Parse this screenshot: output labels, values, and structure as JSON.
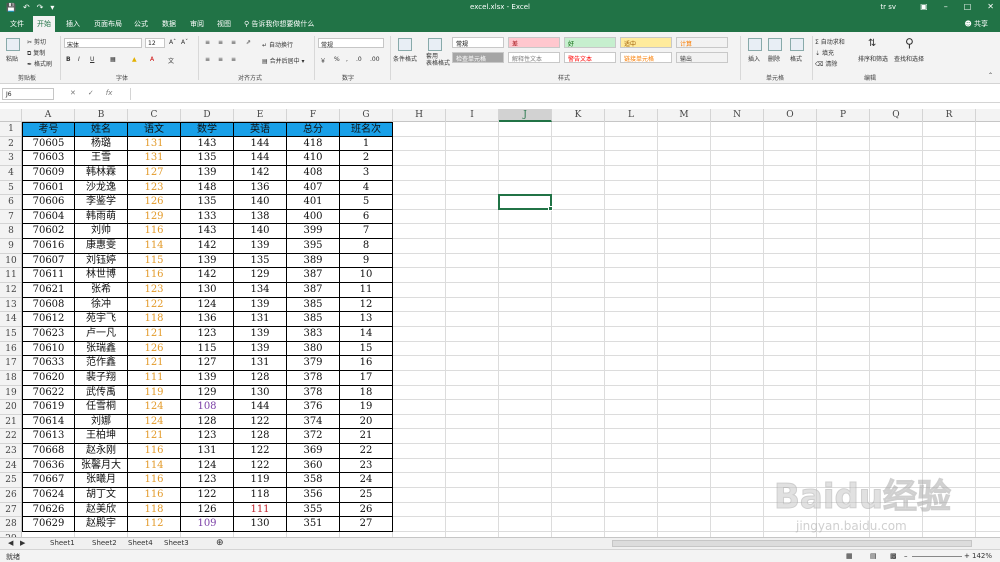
{
  "window": {
    "title": "excel.xlsx - Excel",
    "user": "tr sv",
    "share": "共享"
  },
  "tabs": [
    "文件",
    "开始",
    "插入",
    "页面布局",
    "公式",
    "数据",
    "审阅",
    "视图"
  ],
  "tell_me": "告诉我你想要做什么",
  "ribbon": {
    "clipboard": {
      "paste": "粘贴",
      "cut": "剪切",
      "copy": "复制",
      "format_painter": "格式刷",
      "label": "剪贴板"
    },
    "font": {
      "name": "宋体",
      "size": "12",
      "label": "字体"
    },
    "alignment": {
      "wrap": "自动换行",
      "merge": "合并后居中",
      "label": "对齐方式"
    },
    "number": {
      "format": "常规",
      "label": "数字"
    },
    "styles": {
      "cond": "条件格式",
      "table": "套用\n表格格式",
      "cells": [
        {
          "text": "常规",
          "bg": "#ffffff",
          "fg": "#000000"
        },
        {
          "text": "差",
          "bg": "#ffc7ce",
          "fg": "#9c0006"
        },
        {
          "text": "好",
          "bg": "#c6efce",
          "fg": "#006100"
        },
        {
          "text": "适中",
          "bg": "#ffeb9c",
          "fg": "#9c5700"
        },
        {
          "text": "计算",
          "bg": "#f2f2f2",
          "fg": "#fa7d00"
        },
        {
          "text": "检查单元格",
          "bg": "#a5a5a5",
          "fg": "#ffffff"
        },
        {
          "text": "解释性文本",
          "bg": "#ffffff",
          "fg": "#7f7f7f"
        },
        {
          "text": "警告文本",
          "bg": "#ffffff",
          "fg": "#ff0000"
        },
        {
          "text": "链接单元格",
          "bg": "#ffffff",
          "fg": "#fa7d00"
        },
        {
          "text": "输出",
          "bg": "#f2f2f2",
          "fg": "#3f3f3f"
        }
      ],
      "label": "样式"
    },
    "cells": {
      "insert": "插入",
      "delete": "删除",
      "format": "格式",
      "label": "单元格"
    },
    "editing": {
      "autosum": "自动求和",
      "fill": "填充",
      "clear": "清除",
      "sort": "排序和筛选",
      "find": "查找和选择",
      "label": "编辑"
    }
  },
  "formula_bar": {
    "name_box": "J6",
    "fx": "fx",
    "value": ""
  },
  "columns": [
    "A",
    "B",
    "C",
    "D",
    "E",
    "F",
    "G",
    "H",
    "I",
    "J",
    "K",
    "L",
    "M",
    "N",
    "O",
    "P",
    "Q",
    "R"
  ],
  "selected_column": "J",
  "headers": [
    "考号",
    "姓名",
    "语文",
    "数学",
    "英语",
    "总分",
    "班名次"
  ],
  "rows": [
    [
      "70605",
      "杨璐",
      "131",
      "143",
      "144",
      "418",
      "1"
    ],
    [
      "70603",
      "王雪",
      "131",
      "135",
      "144",
      "410",
      "2"
    ],
    [
      "70609",
      "韩林霖",
      "127",
      "139",
      "142",
      "408",
      "3"
    ],
    [
      "70601",
      "沙龙逸",
      "123",
      "148",
      "136",
      "407",
      "4"
    ],
    [
      "70606",
      "李鉴学",
      "126",
      "135",
      "140",
      "401",
      "5"
    ],
    [
      "70604",
      "韩雨萌",
      "129",
      "133",
      "138",
      "400",
      "6"
    ],
    [
      "70602",
      "刘帅",
      "116",
      "143",
      "140",
      "399",
      "7"
    ],
    [
      "70616",
      "康惠雯",
      "114",
      "142",
      "139",
      "395",
      "8"
    ],
    [
      "70607",
      "刘钰婷",
      "115",
      "139",
      "135",
      "389",
      "9"
    ],
    [
      "70611",
      "林世博",
      "116",
      "142",
      "129",
      "387",
      "10"
    ],
    [
      "70621",
      "张希",
      "123",
      "130",
      "134",
      "387",
      "11"
    ],
    [
      "70608",
      "徐冲",
      "122",
      "124",
      "139",
      "385",
      "12"
    ],
    [
      "70612",
      "苑宇飞",
      "118",
      "136",
      "131",
      "385",
      "13"
    ],
    [
      "70623",
      "卢一凡",
      "121",
      "123",
      "139",
      "383",
      "14"
    ],
    [
      "70610",
      "张瑞鑫",
      "126",
      "115",
      "139",
      "380",
      "15"
    ],
    [
      "70633",
      "范作鑫",
      "121",
      "127",
      "131",
      "379",
      "16"
    ],
    [
      "70620",
      "裴子翔",
      "111",
      "139",
      "128",
      "378",
      "17"
    ],
    [
      "70622",
      "武传禹",
      "119",
      "129",
      "130",
      "378",
      "18"
    ],
    [
      "70619",
      "任雪桐",
      "124",
      "108",
      "144",
      "376",
      "19"
    ],
    [
      "70614",
      "刘娜",
      "124",
      "128",
      "122",
      "374",
      "20"
    ],
    [
      "70613",
      "王柏坤",
      "121",
      "123",
      "128",
      "372",
      "21"
    ],
    [
      "70668",
      "赵永刚",
      "116",
      "131",
      "122",
      "369",
      "22"
    ],
    [
      "70636",
      "张馨月大",
      "114",
      "124",
      "122",
      "360",
      "23"
    ],
    [
      "70667",
      "张曦月",
      "116",
      "123",
      "119",
      "358",
      "24"
    ],
    [
      "70624",
      "胡丁文",
      "116",
      "122",
      "118",
      "356",
      "25"
    ],
    [
      "70626",
      "赵美欣",
      "118",
      "126",
      "111",
      "355",
      "26"
    ],
    [
      "70629",
      "赵殿宇",
      "112",
      "109",
      "130",
      "351",
      "27"
    ]
  ],
  "colors": {
    "excel_green": "#217346",
    "header_fill": "#19a0e8",
    "chinese_score": "#e39b2b",
    "low_math": "#7b3fa6",
    "low_english": "#c0232c"
  },
  "sheets": [
    "Sheet1",
    "Sheet2",
    "Sheet4",
    "Sheet3"
  ],
  "active_sheet": "Sheet1",
  "status": {
    "ready": "就绪",
    "zoom": "142%"
  },
  "watermark": {
    "text": "Baidu经验",
    "url": "jingyan.baidu.com"
  }
}
